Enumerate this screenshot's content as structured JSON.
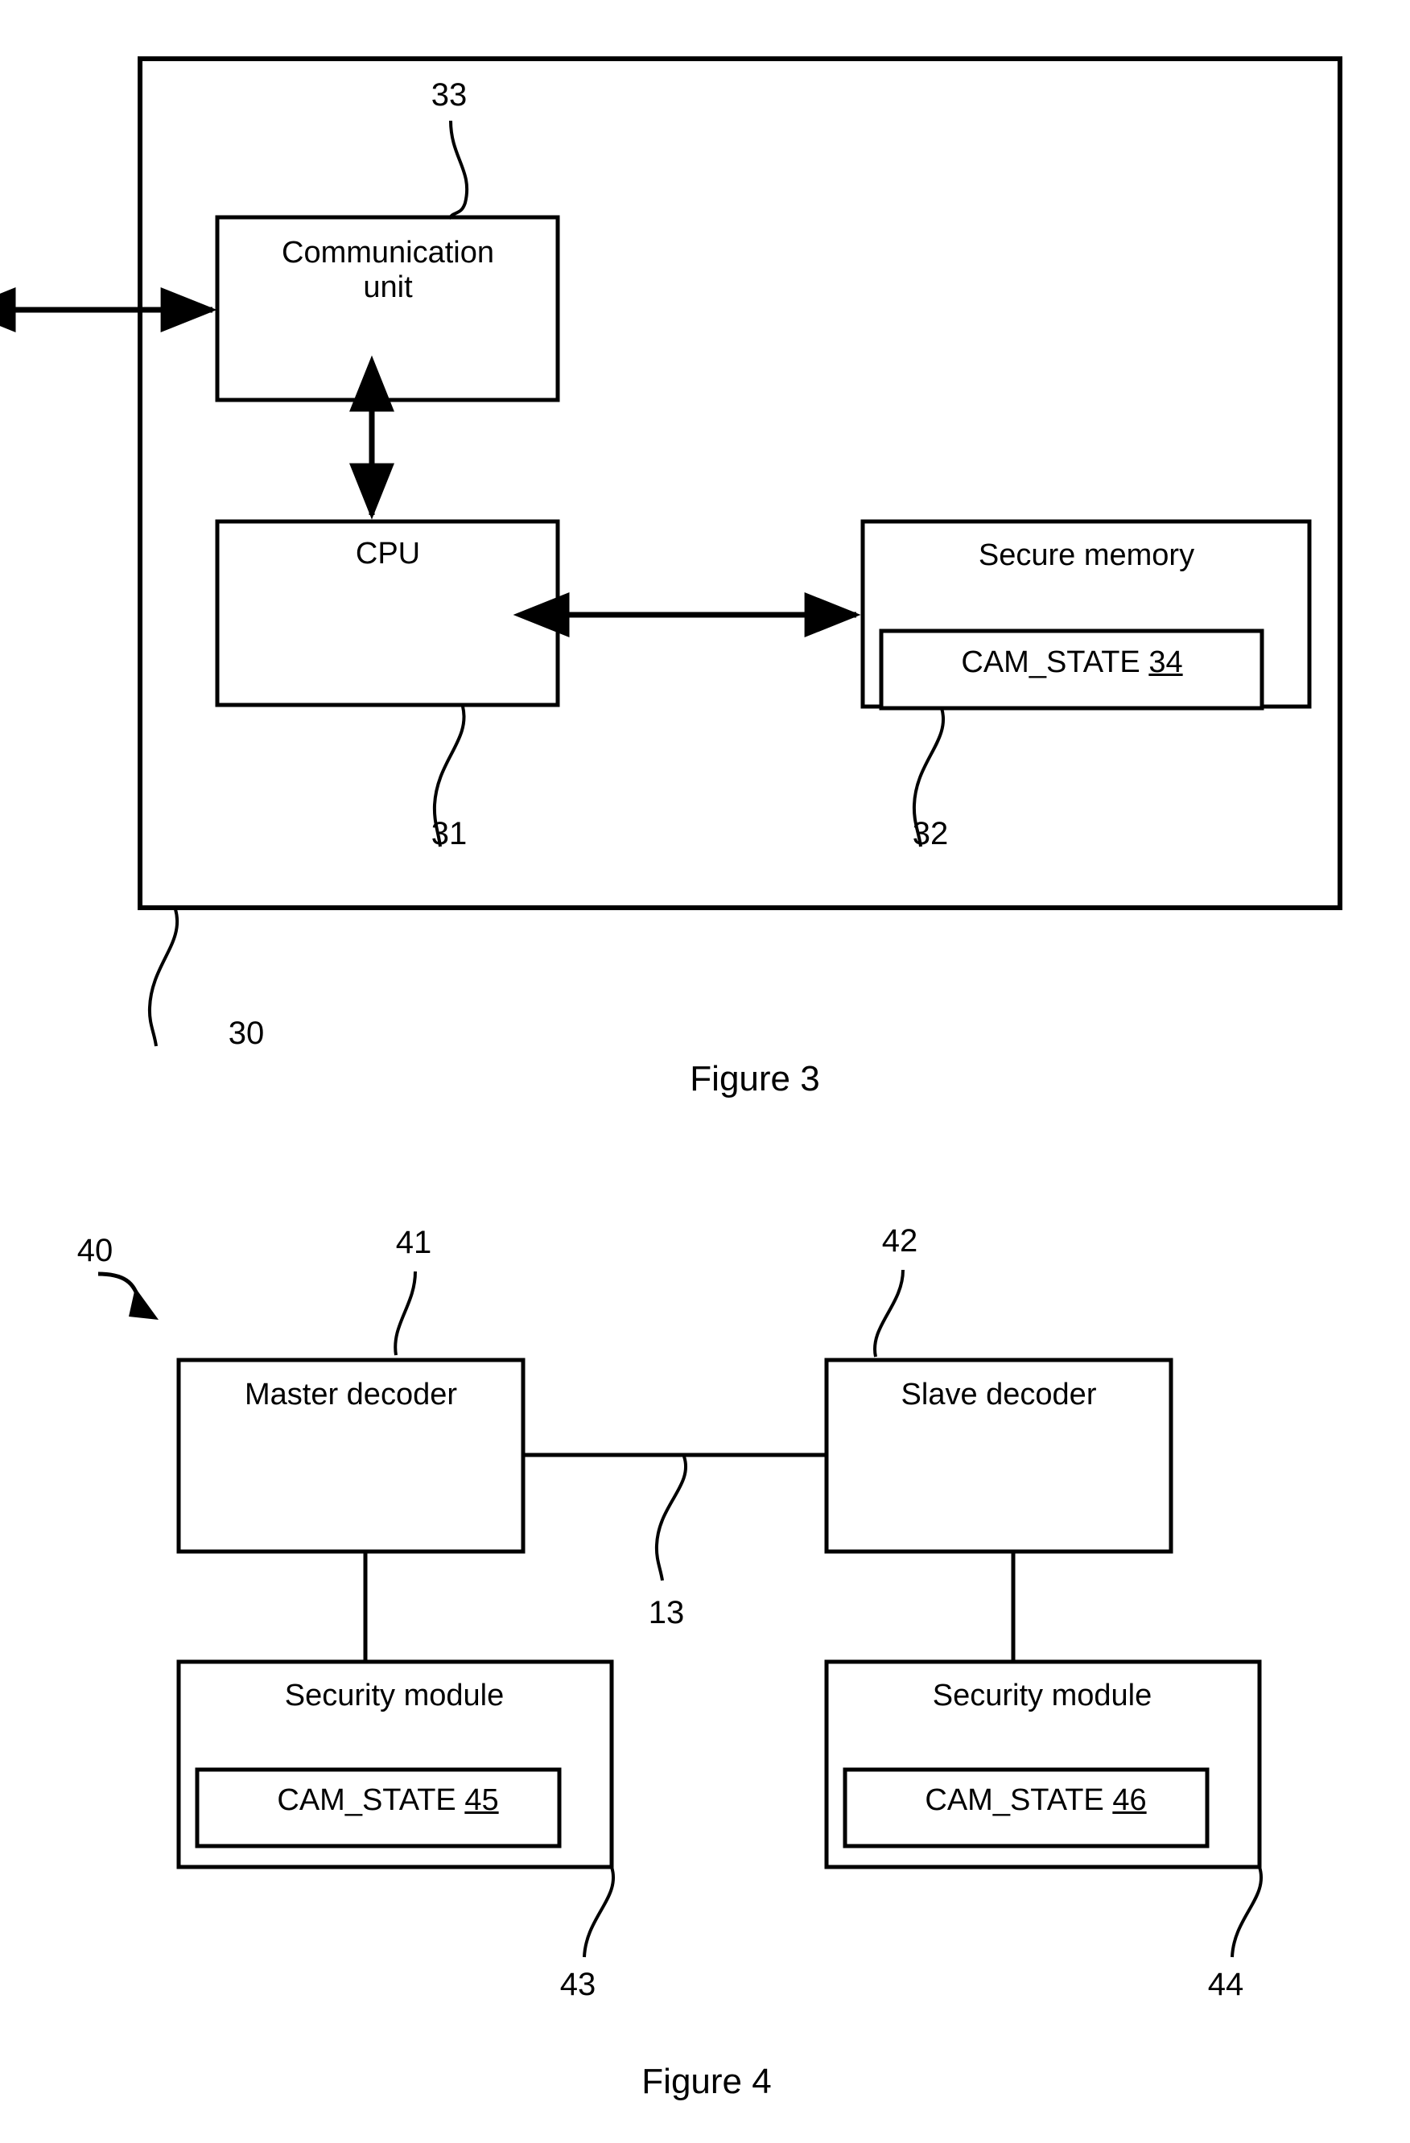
{
  "document": {
    "type": "patent-drawing-sheet",
    "figures": [
      {
        "id": "figure-3",
        "caption": "Figure 3",
        "outer_ref": "30",
        "blocks": [
          {
            "id": "communication-unit",
            "label_line1": "Communication",
            "label_line2": "unit",
            "ref": "33"
          },
          {
            "id": "cpu",
            "label": "CPU",
            "ref": "31"
          },
          {
            "id": "secure-memory",
            "label": "Secure memory",
            "ref": "32",
            "inner": {
              "id": "cam-state-34",
              "name": "CAM_STATE",
              "number": "34"
            }
          }
        ]
      },
      {
        "id": "figure-4",
        "caption": "Figure 4",
        "system_ref": "40",
        "link_ref": "13",
        "blocks": [
          {
            "id": "master-decoder",
            "label": "Master decoder",
            "ref": "41"
          },
          {
            "id": "slave-decoder",
            "label": "Slave decoder",
            "ref": "42"
          },
          {
            "id": "security-module-left",
            "label": "Security module",
            "ref": "43",
            "inner": {
              "id": "cam-state-45",
              "name": "CAM_STATE",
              "number": "45"
            }
          },
          {
            "id": "security-module-right",
            "label": "Security module",
            "ref": "44",
            "inner": {
              "id": "cam-state-46",
              "name": "CAM_STATE",
              "number": "46"
            }
          }
        ]
      }
    ]
  },
  "figure3": {
    "communication_unit_line1": "Communication",
    "communication_unit_line2": "unit",
    "cpu": "CPU",
    "secure_memory": "Secure memory",
    "cam_state_name": "CAM_STATE",
    "cam_state_number": "34",
    "ref_33": "33",
    "ref_31": "31",
    "ref_32": "32",
    "ref_30": "30",
    "caption": "Figure 3"
  },
  "figure4": {
    "ref_40": "40",
    "ref_41": "41",
    "ref_42": "42",
    "ref_13": "13",
    "ref_43": "43",
    "ref_44": "44",
    "master_decoder": "Master decoder",
    "slave_decoder": "Slave decoder",
    "security_module_left": "Security module",
    "security_module_right": "Security module",
    "cam_state_name_left": "CAM_STATE",
    "cam_state_number_left": "45",
    "cam_state_name_right": "CAM_STATE",
    "cam_state_number_right": "46",
    "caption": "Figure 4"
  },
  "style": {
    "ink": "#000000",
    "paper": "#ffffff"
  }
}
